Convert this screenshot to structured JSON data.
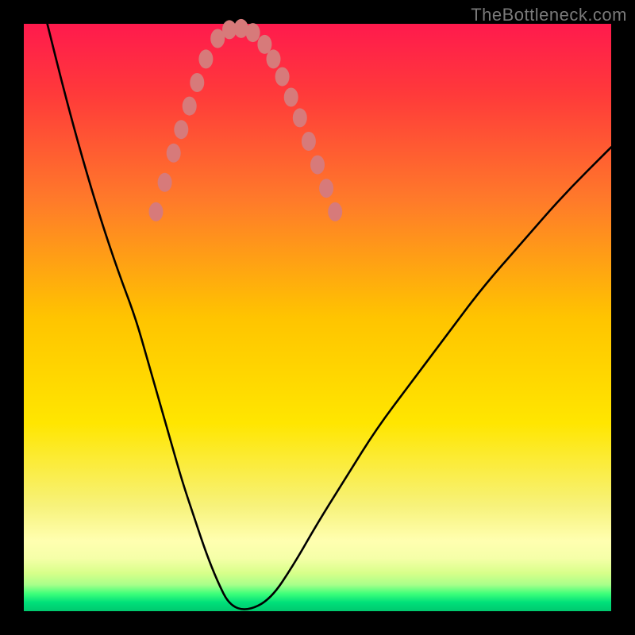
{
  "watermark": "TheBottleneck.com",
  "chart_data": {
    "type": "line",
    "title": "",
    "xlabel": "",
    "ylabel": "",
    "xlim": [
      0,
      100
    ],
    "ylim": [
      0,
      100
    ],
    "series": [
      {
        "name": "bottleneck-curve",
        "x": [
          4,
          7,
          10,
          13,
          16,
          19,
          21,
          23,
          25,
          27,
          29,
          31,
          33,
          35,
          38,
          42,
          46,
          50,
          55,
          60,
          66,
          72,
          78,
          85,
          92,
          100
        ],
        "values": [
          100,
          88,
          77,
          67,
          58,
          50,
          43,
          36,
          29,
          22,
          16,
          10,
          5,
          1,
          0,
          2,
          8,
          15,
          23,
          31,
          39,
          47,
          55,
          63,
          71,
          79
        ]
      }
    ],
    "dots": {
      "name": "highlight-dots",
      "coords": [
        [
          22.5,
          68
        ],
        [
          24.0,
          73
        ],
        [
          25.5,
          78
        ],
        [
          26.8,
          82
        ],
        [
          28.2,
          86
        ],
        [
          29.5,
          90
        ],
        [
          31.0,
          94
        ],
        [
          33.0,
          97.5
        ],
        [
          35.0,
          99
        ],
        [
          37.0,
          99.2
        ],
        [
          39.0,
          98.5
        ],
        [
          41.0,
          96.5
        ],
        [
          42.5,
          94
        ],
        [
          44.0,
          91
        ],
        [
          45.5,
          87.5
        ],
        [
          47.0,
          84
        ],
        [
          48.5,
          80
        ],
        [
          50.0,
          76
        ],
        [
          51.5,
          72
        ],
        [
          53.0,
          68
        ]
      ]
    },
    "gradient_stops": [
      {
        "pos": 0,
        "color": "#ff1a4d"
      },
      {
        "pos": 50,
        "color": "#ffe600"
      },
      {
        "pos": 97,
        "color": "#3fff7a"
      },
      {
        "pos": 100,
        "color": "#00c86e"
      }
    ],
    "curve_color": "#000000",
    "dot_color": "#d77a7a"
  }
}
